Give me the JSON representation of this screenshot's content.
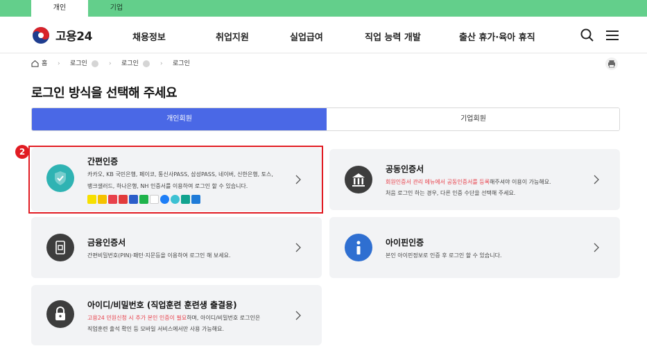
{
  "top_tabs": [
    "개인",
    "기업"
  ],
  "logo_text": "고용24",
  "nav": [
    "채용정보",
    "취업지원",
    "실업급여",
    "직업 능력 개발",
    "출산 휴가·육아 휴직"
  ],
  "breadcrumb": [
    "홈",
    "로그인",
    "로그인",
    "로그인"
  ],
  "page_title": "로그인 방식을 선택해 주세요",
  "member_tabs": [
    "개인회원",
    "기업회원"
  ],
  "marker": "2",
  "cards": {
    "simple": {
      "title": "간편인증",
      "desc1": "카카오, KB 국민은행, 페이코, 통신사PASS, 삼성PASS, 네이버, 신한은행, 토스,",
      "desc2": "뱅크샐러드, 하나은행, NH 인증서를 이용하여 로그인 할 수 있습니다."
    },
    "joint": {
      "title": "공동인증서",
      "desc1_red": "회원인증서 관리 메뉴에서 공동인증서를 등록",
      "desc1_rest": "해주셔야 이용이 가능해요.",
      "desc2": "처음 로그인 하는 경우, 다른 인증 수단을 선택해 주세요."
    },
    "finance": {
      "title": "금융인증서",
      "desc1": "간편비밀번호(PIN)·패턴·지문등을 이용하여 로그인 해 보세요."
    },
    "ipin": {
      "title": "아이핀인증",
      "desc1": "본인 아이핀정보로 인증 후 로그인 할 수 있습니다."
    },
    "idpw": {
      "title": "아이디/비밀번호 (직업훈련 훈련생 출결용)",
      "desc1_red": "고용24 민원신청 시 추가 본인 인증이 필요",
      "desc1_rest": "하며, 아이디/비밀번호 로그인은",
      "desc2": "직업훈련 출석 확인 등 모바일 서비스에서만 사용 가능해요."
    }
  },
  "colors": {
    "top_bar": "#63cf8b",
    "accent": "#4a68e6",
    "highlight": "#e11b22",
    "simple_icon": "#2fb3b3",
    "dark_icon": "#3d3d3d",
    "ipin_icon": "#2f6fd1"
  }
}
